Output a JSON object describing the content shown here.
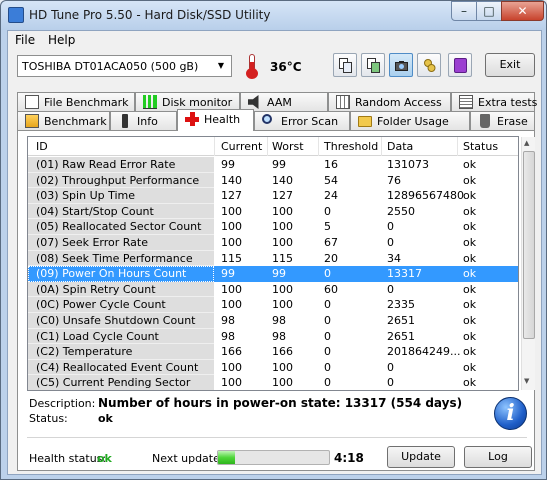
{
  "window": {
    "title": "HD Tune Pro 5.50 - Hard Disk/SSD Utility",
    "min": "–",
    "max": "□",
    "close": "✕"
  },
  "menu": {
    "file": "File",
    "help": "Help"
  },
  "toolbar": {
    "drive": "TOSHIBA DT01ACA050 (500 gB)",
    "temperature": "36°C",
    "exit_label": "Exit"
  },
  "tabs_top": [
    "File Benchmark",
    "Disk monitor",
    "AAM",
    "Random Access",
    "Extra tests"
  ],
  "tabs_bottom": [
    "Benchmark",
    "Info",
    "Health",
    "Error Scan",
    "Folder Usage",
    "Erase"
  ],
  "active_tab": "Health",
  "table": {
    "columns": [
      "ID",
      "Current",
      "Worst",
      "Threshold",
      "Data",
      "Status"
    ],
    "rows": [
      [
        "(01) Raw Read Error Rate",
        "99",
        "99",
        "16",
        "131073",
        "ok"
      ],
      [
        "(02) Throughput Performance",
        "140",
        "140",
        "54",
        "76",
        "ok"
      ],
      [
        "(03) Spin Up Time",
        "127",
        "127",
        "24",
        "12896567480",
        "ok"
      ],
      [
        "(04) Start/Stop Count",
        "100",
        "100",
        "0",
        "2550",
        "ok"
      ],
      [
        "(05) Reallocated Sector Count",
        "100",
        "100",
        "5",
        "0",
        "ok"
      ],
      [
        "(07) Seek Error Rate",
        "100",
        "100",
        "67",
        "0",
        "ok"
      ],
      [
        "(08) Seek Time Performance",
        "115",
        "115",
        "20",
        "34",
        "ok"
      ],
      [
        "(09) Power On Hours Count",
        "99",
        "99",
        "0",
        "13317",
        "ok"
      ],
      [
        "(0A) Spin Retry Count",
        "100",
        "100",
        "60",
        "0",
        "ok"
      ],
      [
        "(0C) Power Cycle Count",
        "100",
        "100",
        "0",
        "2335",
        "ok"
      ],
      [
        "(C0) Unsafe Shutdown Count",
        "98",
        "98",
        "0",
        "2651",
        "ok"
      ],
      [
        "(C1) Load Cycle Count",
        "98",
        "98",
        "0",
        "2651",
        "ok"
      ],
      [
        "(C2) Temperature",
        "166",
        "166",
        "0",
        "201864249...",
        "ok"
      ],
      [
        "(C4) Reallocated Event Count",
        "100",
        "100",
        "0",
        "0",
        "ok"
      ],
      [
        "(C5) Current Pending Sector",
        "100",
        "100",
        "0",
        "0",
        "ok"
      ]
    ],
    "selected_row": 7
  },
  "details": {
    "description_label": "Description:",
    "description_value": "Number of hours in power-on state: 13317 (554 days)",
    "status_label": "Status:",
    "status_value": "ok"
  },
  "footer": {
    "health_label": "Health status:",
    "health_value": "ok",
    "next_update_label": "Next update:",
    "progress_fraction": 0.15,
    "countdown": "4:18",
    "update_label": "Update",
    "log_label": "Log"
  },
  "colors": {
    "selection": "#3399ff",
    "ok_green": "#22aa22",
    "progress_green": "#4fd63a"
  }
}
